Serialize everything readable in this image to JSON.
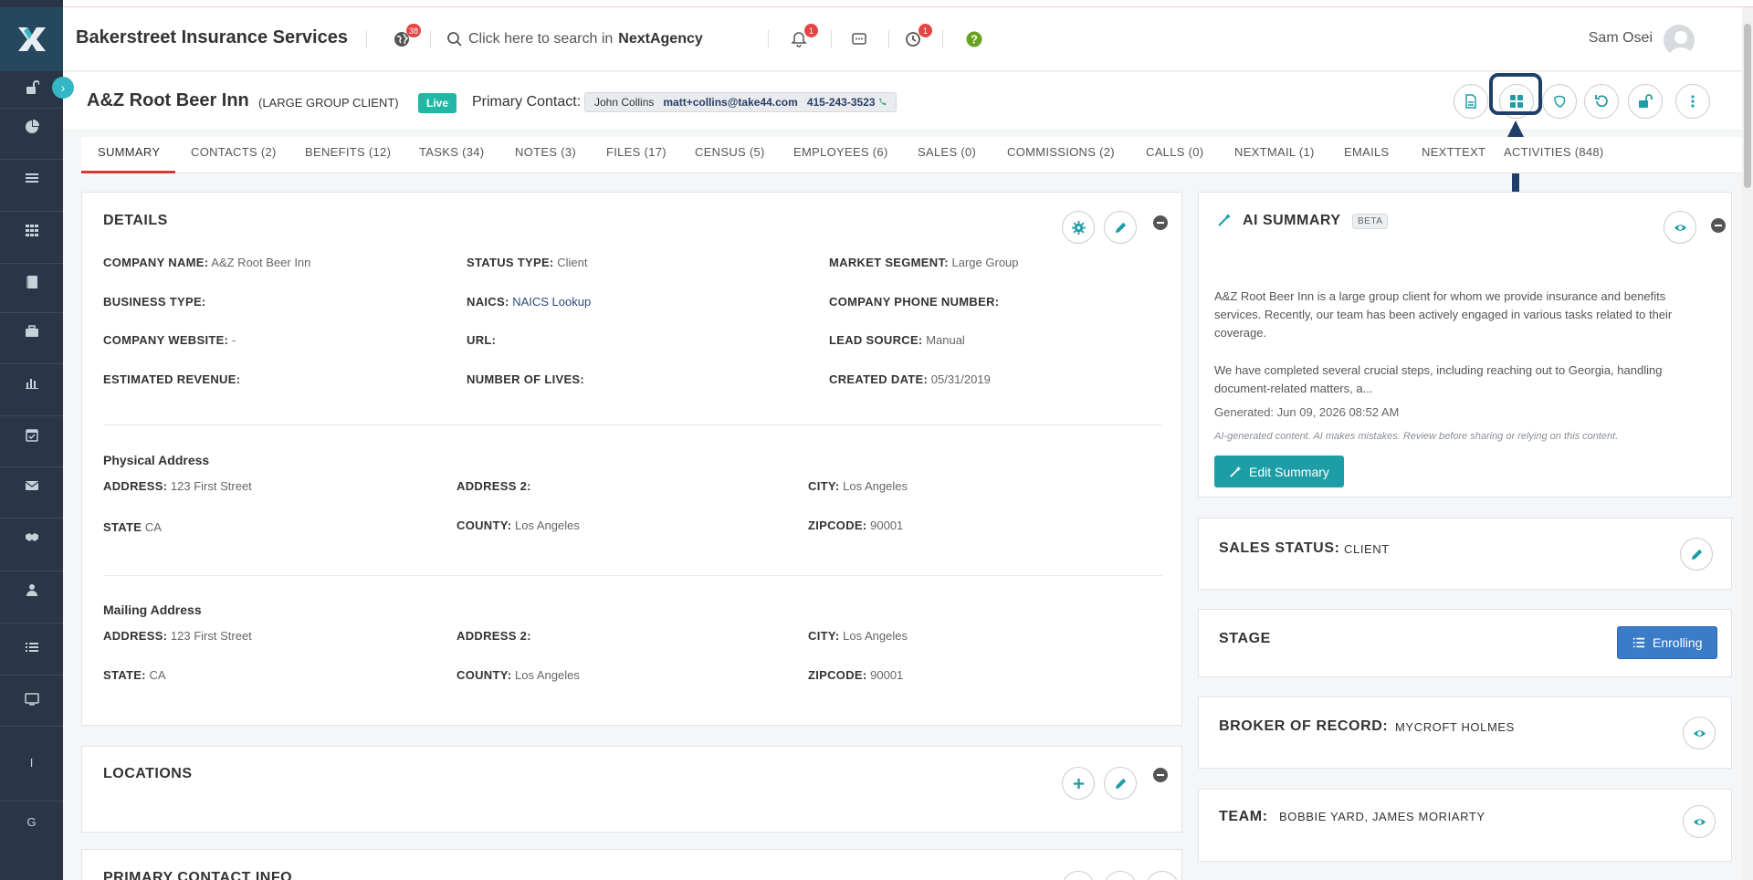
{
  "header": {
    "brand": "Bakerstreet Insurance Services",
    "globe_badge": "38",
    "search_prefix": "Click here to search in",
    "search_app": "NextAgency",
    "bell_badge": "1",
    "clock_badge": "1",
    "help_icon": "question-circle",
    "user_name": "Sam Osei"
  },
  "client": {
    "name": "A&Z Root Beer Inn",
    "type": "(LARGE GROUP CLIENT)",
    "status_badge": "Live",
    "primary_contact_label": "Primary Contact:",
    "contact_name": "John Collins",
    "contact_email": "matt+collins@take44.com",
    "contact_phone": "415-243-3523"
  },
  "tabs": [
    {
      "label": "SUMMARY"
    },
    {
      "label": "CONTACTS (2)"
    },
    {
      "label": "BENEFITS (12)"
    },
    {
      "label": "TASKS (34)"
    },
    {
      "label": "NOTES (3)"
    },
    {
      "label": "FILES (17)"
    },
    {
      "label": "CENSUS (5)"
    },
    {
      "label": "EMPLOYEES (6)"
    },
    {
      "label": "SALES (0)"
    },
    {
      "label": "COMMISSIONS (2)"
    },
    {
      "label": "CALLS (0)"
    },
    {
      "label": "NEXTMAIL (1)"
    },
    {
      "label": "EMAILS"
    },
    {
      "label": "NEXTTEXT"
    },
    {
      "label": "ACTIVITIES (848)"
    }
  ],
  "details": {
    "title": "DETAILS",
    "company_name_label": "COMPANY NAME:",
    "company_name": "A&Z Root Beer Inn",
    "status_type_label": "STATUS TYPE:",
    "status_type": "Client",
    "market_segment_label": "MARKET SEGMENT:",
    "market_segment": "Large Group",
    "business_type_label": "BUSINESS TYPE:",
    "naics_label": "NAICS:",
    "naics_link": "NAICS Lookup",
    "company_phone_label": "COMPANY PHONE NUMBER:",
    "company_website_label": "COMPANY WEBSITE:",
    "company_website": "-",
    "url_label": "URL:",
    "lead_source_label": "LEAD SOURCE:",
    "lead_source": "Manual",
    "est_revenue_label": "ESTIMATED REVENUE:",
    "num_lives_label": "NUMBER OF LIVES:",
    "created_date_label": "CREATED DATE:",
    "created_date": "05/31/2019"
  },
  "physical": {
    "title": "Physical Address",
    "address_label": "ADDRESS:",
    "address": "123 First Street",
    "address2_label": "ADDRESS 2:",
    "city_label": "CITY:",
    "city": "Los Angeles",
    "state_label": "STATE",
    "state": "CA",
    "county_label": "COUNTY:",
    "county": "Los Angeles",
    "zip_label": "ZIPCODE:",
    "zip": "90001"
  },
  "mailing": {
    "title": "Mailing Address",
    "address_label": "ADDRESS:",
    "address": "123 First Street",
    "address2_label": "ADDRESS 2:",
    "city_label": "CITY:",
    "city": "Los Angeles",
    "state_label": "STATE:",
    "state": "CA",
    "county_label": "COUNTY:",
    "county": "Los Angeles",
    "zip_label": "ZIPCODE:",
    "zip": "90001"
  },
  "locations": {
    "title": "LOCATIONS"
  },
  "primary_contact_info": {
    "title": "PRIMARY CONTACT INFO"
  },
  "ai_summary": {
    "title": "AI SUMMARY",
    "beta": "BETA",
    "para1": "A&Z Root Beer Inn is a large group client for whom we provide insurance and benefits services. Recently, our team has been actively engaged in various tasks related to their coverage.",
    "para2": "We have completed several crucial steps, including reaching out to Georgia, handling document-related matters, a...",
    "generated": "Generated: Jun 09, 2026 08:52 AM",
    "note": "AI-generated content. AI makes mistakes. Review before sharing or relying on this content.",
    "edit_label": "Edit Summary"
  },
  "sales_status": {
    "label": "SALES STATUS:",
    "value": "CLIENT"
  },
  "stage": {
    "label": "STAGE",
    "button": "Enrolling"
  },
  "broker": {
    "label": "BROKER OF RECORD:",
    "value": "MYCROFT HOLMES"
  },
  "team": {
    "label": "TEAM:",
    "value": "BOBBIE YARD, JAMES MORIARTY"
  },
  "sidebar": {
    "letters": [
      "I",
      "G"
    ]
  },
  "colors": {
    "accent": "#1d9da5",
    "sidebar": "#2a3647",
    "tab_active": "#d53a3a",
    "live": "#21b8a6",
    "enroll": "#3a7cc8"
  }
}
